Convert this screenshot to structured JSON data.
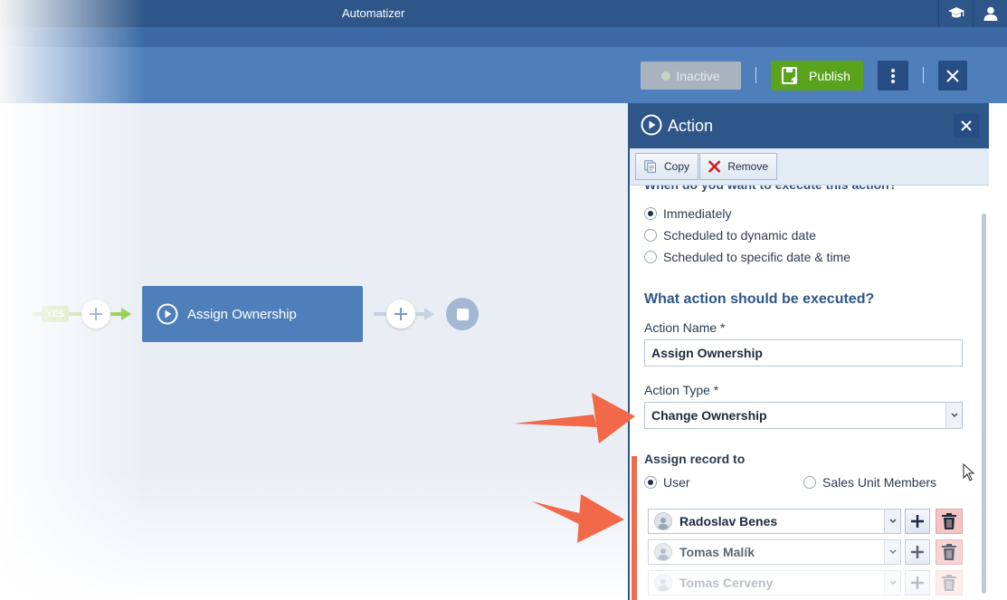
{
  "app": {
    "title": "Automatizer"
  },
  "toolbar": {
    "inactive_label": "Inactive",
    "publish_label": "Publish"
  },
  "canvas": {
    "yes_label": "YES",
    "node_label": "Assign Ownership"
  },
  "panel": {
    "title": "Action",
    "copy_label": "Copy",
    "remove_label": "Remove",
    "when_question": "When do you want to execute this action?",
    "timing_options": [
      {
        "label": "Immediately",
        "selected": true
      },
      {
        "label": "Scheduled to dynamic date",
        "selected": false
      },
      {
        "label": "Scheduled to specific date & time",
        "selected": false
      }
    ],
    "what_title": "What action should be executed?",
    "action_name_label": "Action Name *",
    "action_name_value": "Assign Ownership",
    "action_type_label": "Action Type *",
    "action_type_value": "Change Ownership",
    "assign_title": "Assign record to",
    "assign_options": [
      {
        "label": "User",
        "selected": true
      },
      {
        "label": "Sales Unit Members",
        "selected": false
      }
    ],
    "users": [
      {
        "name": "Radoslav Benes"
      },
      {
        "name": "Tomas Malík"
      },
      {
        "name": "Tomas Cerveny"
      }
    ]
  },
  "colors": {
    "header": "#2f5688",
    "publish": "#5aa31d",
    "node": "#4e7fba",
    "annotation_arrow": "#f2694a"
  }
}
